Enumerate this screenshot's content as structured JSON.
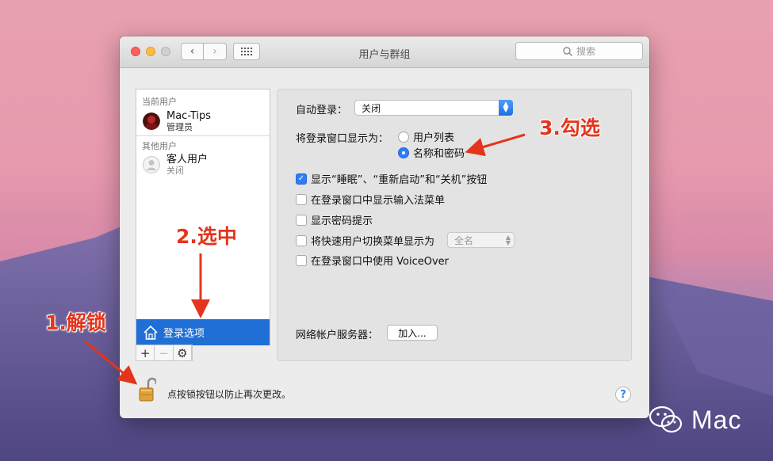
{
  "window": {
    "title": "用户与群组",
    "search_placeholder": "搜索"
  },
  "sidebar": {
    "current_users_label": "当前用户",
    "current_user": {
      "name": "Mac-Tips",
      "role": "管理员"
    },
    "other_users_label": "其他用户",
    "other_user": {
      "name": "客人用户",
      "status": "关闭"
    },
    "login_options_label": "登录选项",
    "tools": {
      "add": "+",
      "remove": "−",
      "gear": "⚙"
    }
  },
  "login_panel": {
    "auto_login_label": "自动登录：",
    "auto_login_value": "关闭",
    "display_window_label": "将登录窗口显示为：",
    "radio_options": [
      {
        "label": "用户列表",
        "selected": false
      },
      {
        "label": "名称和密码",
        "selected": true
      }
    ],
    "checkboxes": [
      {
        "label": "显示“睡眠”、“重新启动”和“关机”按钮",
        "checked": true
      },
      {
        "label": "在登录窗口中显示输入法菜单",
        "checked": false
      },
      {
        "label": "显示密码提示",
        "checked": false
      },
      {
        "label": "将快速用户切换菜单显示为",
        "checked": false
      },
      {
        "label": "在登录窗口中使用 VoiceOver",
        "checked": false
      }
    ],
    "fast_switch_value": "全名",
    "network_server_label": "网络帐户服务器：",
    "join_button": "加入..."
  },
  "footer": {
    "lock_text": "点按锁按钮以防止再次更改。",
    "help": "?"
  },
  "annotations": {
    "step1": "1.解锁",
    "step2": "2.选中",
    "step3": "3.勾选",
    "color": "#e4341c"
  },
  "watermark": {
    "text": "Mac"
  },
  "colors": {
    "accent": "#1f6fd5",
    "close": "#fc605c",
    "minimize": "#fdbc40"
  }
}
